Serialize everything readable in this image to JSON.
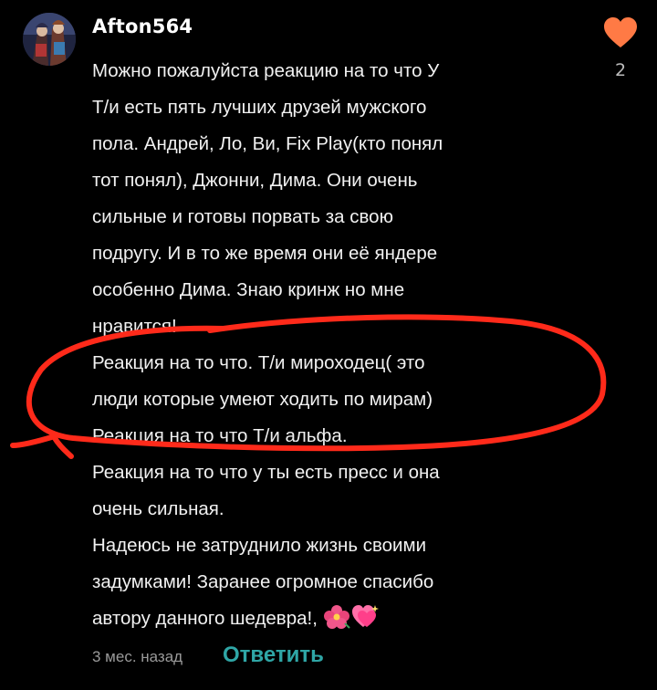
{
  "comment": {
    "author": "Afton564",
    "likes": "2",
    "lines": [
      "Можно пожалуйста реакцию на то что У",
      "Т/и есть пять лучших друзей мужского",
      "пола. Андрей, Ло, Ви, Fix Play(кто понял",
      "тот понял), Джонни, Дима. Они очень",
      "сильные и готовы порвать за свою",
      "подругу. И в то же время они её яндере",
      "особенно Дима. Знаю кринж но мне",
      "нравится!",
      "Реакция на то что. Т/и мироходец( это",
      "люди которые умеют ходить по мирам)",
      "Реакция на то что Т/и альфа.",
      "Реакция на то что у ты есть пресс и она",
      "очень сильная.",
      "Надеюсь не затруднило жизнь своими",
      "задумками! Заранее огромное спасибо",
      "автору данного шедевра!,"
    ],
    "emojis": [
      "hibiscus-emoji",
      "sparkling-heart-emoji"
    ],
    "timestamp": "3 мес. назад",
    "reply_label": "Ответить"
  },
  "colors": {
    "background": "#000000",
    "text": "#f1f1f1",
    "heart": "#ff7a45",
    "reply": "#2fa6a6",
    "annotation": "#ff2a1a"
  }
}
